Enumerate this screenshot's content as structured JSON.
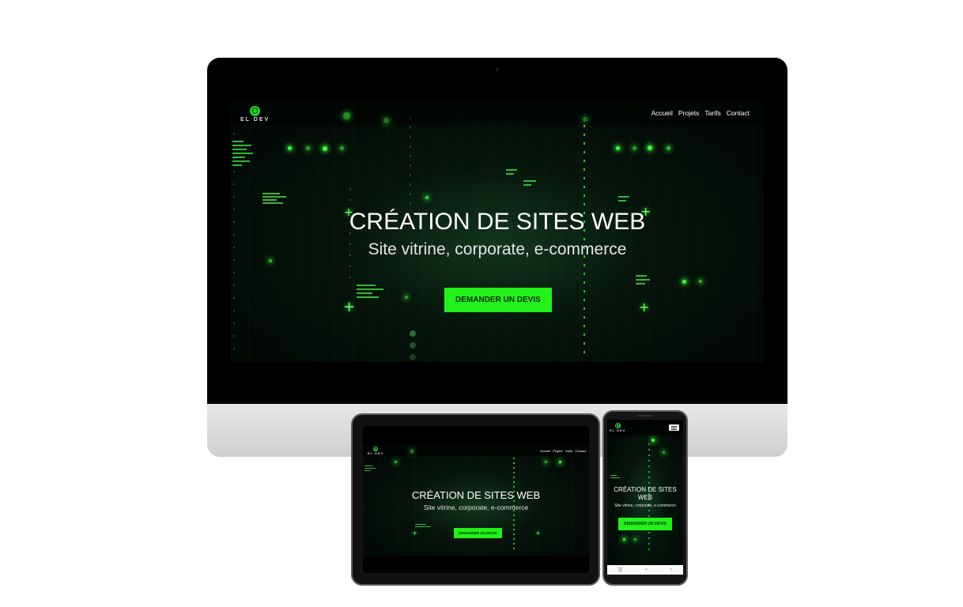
{
  "brand": {
    "logo_text": "EL DEV",
    "accent_color": "#22f21a",
    "background_color": "#040a06"
  },
  "nav": {
    "links": [
      "Accueil",
      "Projets",
      "Tarifs",
      "Contact"
    ]
  },
  "hero": {
    "title": "CRÉATION DE SITES WEB",
    "subtitle": "Site vitrine, corporate, e-commerce",
    "cta_label": "DEMANDER UN DEVIS"
  },
  "icons": {
    "logo": "globe-cursor-icon",
    "menu": "hamburger-menu-icon",
    "decor": "plus-sparkle-icon",
    "phone_nav": [
      "recent-apps-icon",
      "home-icon",
      "back-icon"
    ]
  },
  "phone_nav_glyphs": [
    "|||",
    "○",
    "‹"
  ]
}
